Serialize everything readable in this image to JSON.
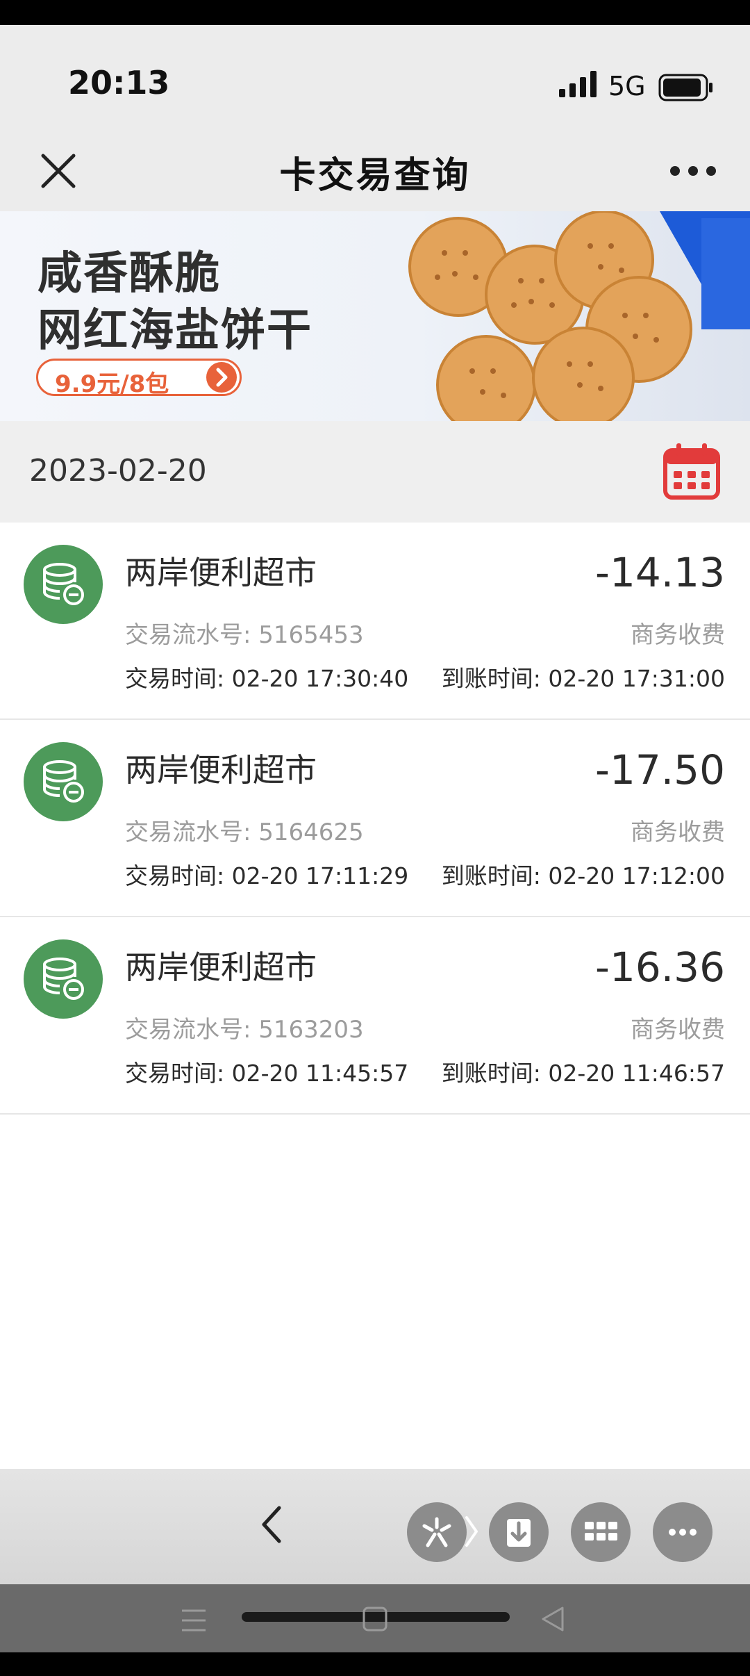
{
  "status_bar": {
    "time": "20:13",
    "network": "5G"
  },
  "header": {
    "title": "卡交易查询"
  },
  "banner": {
    "line1": "咸香酥脆",
    "line2": "网红海盐饼干",
    "price": "9.9元/8包"
  },
  "date_filter": {
    "date": "2023-02-20"
  },
  "transactions": [
    {
      "merchant": "两岸便利超市",
      "amount": "-14.13",
      "serial": "交易流水号: 5165453",
      "category": "商务收费",
      "trade_time": "交易时间: 02-20 17:30:40",
      "arrival_time": "到账时间: 02-20 17:31:00"
    },
    {
      "merchant": "两岸便利超市",
      "amount": "-17.50",
      "serial": "交易流水号: 5164625",
      "category": "商务收费",
      "trade_time": "交易时间: 02-20 17:11:29",
      "arrival_time": "到账时间: 02-20 17:12:00"
    },
    {
      "merchant": "两岸便利超市",
      "amount": "-16.36",
      "serial": "交易流水号: 5163203",
      "category": "商务收费",
      "trade_time": "交易时间: 02-20 11:45:57",
      "arrival_time": "到账时间: 02-20 11:46:57"
    }
  ],
  "colors": {
    "accent_green": "#4d9a5a",
    "calendar_red": "#e23b3b",
    "banner_orange": "#e8623a"
  },
  "icons": {
    "close": "close-icon",
    "more": "more-icon",
    "calendar": "calendar-icon",
    "transaction": "database-minus-icon",
    "back": "chevron-left-icon",
    "bottom_buttons": [
      "sparkle-icon",
      "download-icon",
      "grid-icon",
      "more-icon"
    ]
  }
}
